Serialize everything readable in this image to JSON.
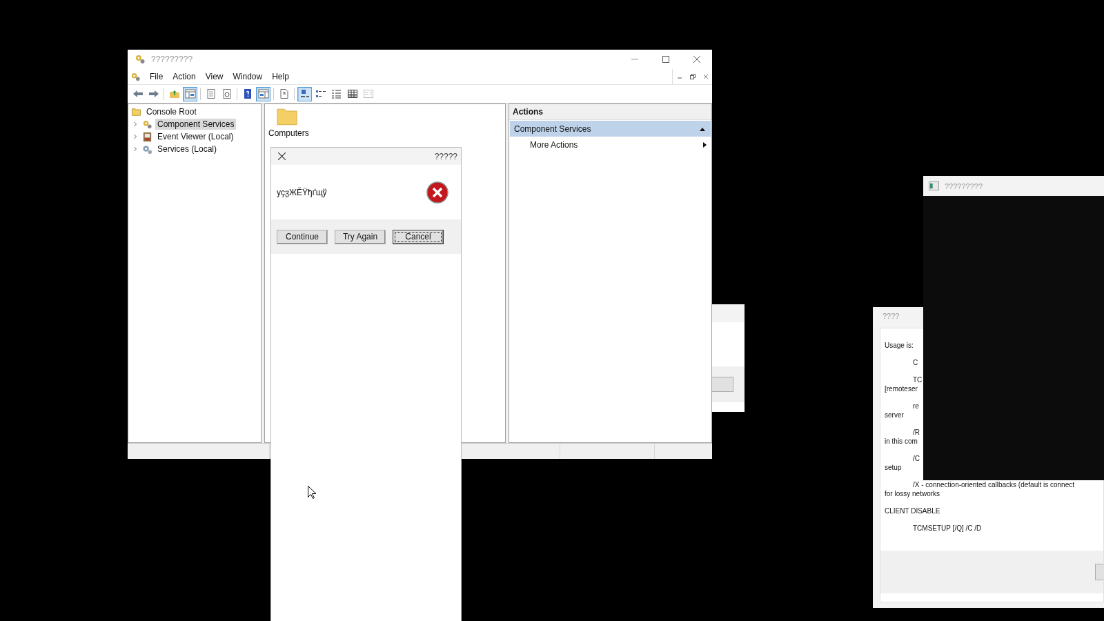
{
  "main_window": {
    "title": "?????????",
    "menu": [
      "File",
      "Action",
      "View",
      "Window",
      "Help"
    ],
    "toolbar": [
      {
        "kind": "back",
        "pressed": false
      },
      {
        "kind": "forward",
        "pressed": false
      },
      {
        "kind": "separator"
      },
      {
        "kind": "up",
        "pressed": false
      },
      {
        "kind": "tree",
        "pressed": true
      },
      {
        "kind": "separator"
      },
      {
        "kind": "properties",
        "pressed": false
      },
      {
        "kind": "refresh",
        "pressed": false
      },
      {
        "kind": "separator"
      },
      {
        "kind": "help",
        "pressed": false
      },
      {
        "kind": "actions-pane",
        "pressed": true
      },
      {
        "kind": "separator"
      },
      {
        "kind": "export",
        "pressed": false
      },
      {
        "kind": "separator"
      },
      {
        "kind": "large-icons",
        "pressed": true
      },
      {
        "kind": "small-icons",
        "pressed": false
      },
      {
        "kind": "list",
        "pressed": false
      },
      {
        "kind": "details",
        "pressed": false
      },
      {
        "kind": "custom",
        "pressed": false
      }
    ],
    "tree": {
      "label": "Console Root",
      "children": [
        {
          "label": "Component Services",
          "kind": "component",
          "selected": true,
          "expanded": false
        },
        {
          "label": "Event Viewer (Local)",
          "kind": "event-viewer",
          "selected": false,
          "expanded": false
        },
        {
          "label": "Services (Local)",
          "kind": "services",
          "selected": false,
          "expanded": false
        }
      ]
    },
    "content_items": [
      {
        "label": "Computers"
      }
    ],
    "actions": {
      "title": "Actions",
      "groups": [
        {
          "label": "Component Services",
          "expanded": true,
          "items": [
            {
              "label": "More Actions"
            }
          ]
        }
      ]
    }
  },
  "error_dialog": {
    "title": "?????",
    "message": "уҫჳЖĔŸђґщў",
    "buttons": [
      {
        "label": "Continue",
        "focused": false
      },
      {
        "label": "Try Again",
        "focused": false
      },
      {
        "label": "Cancel",
        "focused": true
      }
    ]
  },
  "usage_window": {
    "title": "????",
    "lines": [
      {
        "kind": "text",
        "text": "Usage is:"
      },
      {
        "kind": "indented",
        "text": "C"
      },
      {
        "kind": "indented",
        "text": "TC"
      },
      {
        "kind": "wrapped",
        "text": "[remoteser"
      },
      {
        "kind": "indented",
        "text": "re"
      },
      {
        "kind": "wrapped",
        "text": "server"
      },
      {
        "kind": "indented",
        "text": "/R"
      },
      {
        "kind": "wrapped",
        "text": "in this com"
      },
      {
        "kind": "indented",
        "text": "/C"
      },
      {
        "kind": "wrapped",
        "text": "setup"
      },
      {
        "kind": "indented",
        "text": "/X - connection-oriented callbacks (default is connect"
      },
      {
        "kind": "wrapped",
        "text": "for lossy networks"
      },
      {
        "kind": "text",
        "text": "CLIENT DISABLE"
      },
      {
        "kind": "indented",
        "text": "TCMSETUP [/Q] /C /D"
      }
    ]
  },
  "console_window": {
    "title": "?????????"
  }
}
